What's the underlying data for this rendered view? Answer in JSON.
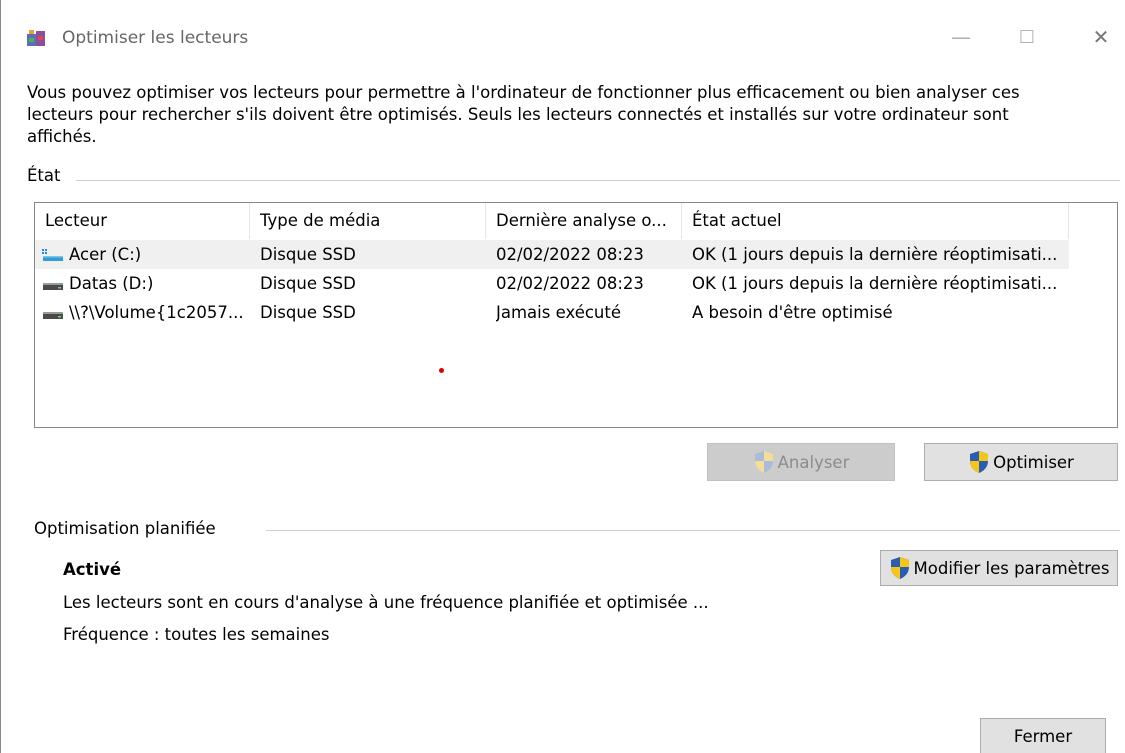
{
  "window": {
    "title": "Optimiser les lecteurs",
    "minimize_glyph": "—",
    "maximize_glyph": "☐",
    "close_glyph": "✕"
  },
  "intro_text": "Vous pouvez optimiser vos lecteurs pour permettre à l'ordinateur de fonctionner plus efficacement ou bien analyser ces\nlecteurs pour rechercher s'ils doivent être optimisés. Seuls les lecteurs connectés et installés sur votre ordinateur sont\naffichés.",
  "status_group": {
    "label": "État",
    "columns": [
      "Lecteur",
      "Type de média",
      "Dernière analyse o...",
      "État actuel"
    ],
    "rows": [
      {
        "drive": "Acer (C:)",
        "media_type": "Disque SSD",
        "last_analysis": "02/02/2022 08:23",
        "status": "OK (1 jours depuis la dernière réoptimisati...",
        "icon": "windows-drive-icon",
        "selected": true
      },
      {
        "drive": "Datas (D:)",
        "media_type": "Disque SSD",
        "last_analysis": "02/02/2022 08:23",
        "status": "OK (1 jours depuis la dernière réoptimisati...",
        "icon": "drive-icon",
        "selected": false
      },
      {
        "drive": "\\\\?\\Volume{1c2057...",
        "media_type": "Disque SSD",
        "last_analysis": "Jamais exécuté",
        "status": "A besoin d'être optimisé",
        "icon": "drive-icon",
        "selected": false
      }
    ]
  },
  "buttons": {
    "analyze": "Analyser",
    "optimize": "Optimiser",
    "change_settings": "Modifier les paramètres",
    "close": "Fermer"
  },
  "scheduled": {
    "label": "Optimisation planifiée",
    "state": "Activé",
    "description": "Les lecteurs sont en cours d'analyse à une fréquence planifiée et optimisée ...",
    "frequency": "Fréquence : toutes les semaines"
  },
  "colors": {
    "shield_blue": "#2a5db0",
    "shield_yellow": "#f5c518",
    "selected_row": "#f0f0f0",
    "button_face": "#e1e1e1"
  }
}
